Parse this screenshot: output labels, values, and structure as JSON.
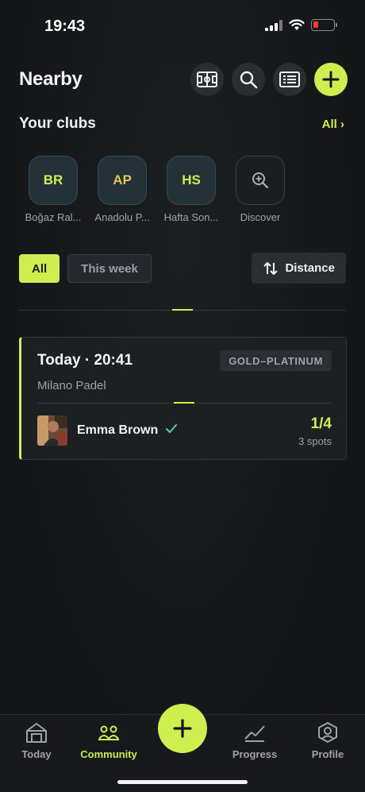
{
  "status_bar": {
    "time": "19:43"
  },
  "header": {
    "title": "Nearby"
  },
  "clubs": {
    "title": "Your clubs",
    "all_link": "All ›",
    "items": [
      {
        "initials": "BR",
        "name": "Boğaz Ral...",
        "color": "#cfee4f"
      },
      {
        "initials": "AP",
        "name": "Anadolu P...",
        "color": "#e6c55a"
      },
      {
        "initials": "HS",
        "name": "Hafta Son...",
        "color": "#cfee4f"
      }
    ],
    "discover_label": "Discover"
  },
  "filters": {
    "all_label": "All",
    "this_week_label": "This week",
    "sort_label": "Distance"
  },
  "game": {
    "time": "Today · 20:41",
    "level": "GOLD–PLATINUM",
    "venue": "Milano Padel",
    "player_name": "Emma Brown",
    "verified_icon": "check-icon",
    "spots_count": "1/4",
    "spots_label": "3 spots"
  },
  "nav": {
    "today": "Today",
    "community": "Community",
    "progress": "Progress",
    "profile": "Profile"
  },
  "colors": {
    "accent": "#cfee4f",
    "background": "#15171a"
  }
}
